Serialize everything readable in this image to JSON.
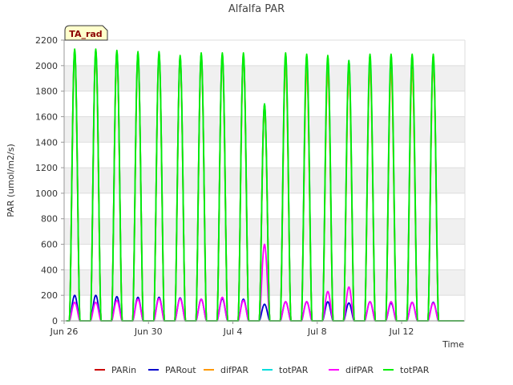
{
  "chart_data": {
    "type": "line",
    "title": "Alfalfa PAR",
    "xlabel": "Time",
    "ylabel": "PAR (umol/m2/s)",
    "badge": "TA_rad",
    "xlim": [
      "2023-06-26",
      "2023-07-15"
    ],
    "ylim": [
      0,
      2200
    ],
    "yticks": [
      0,
      200,
      400,
      600,
      800,
      1000,
      1200,
      1400,
      1600,
      1800,
      2000,
      2200
    ],
    "xticks": [
      {
        "date": "2023-06-26",
        "label": "Jun 26"
      },
      {
        "date": "2023-06-30",
        "label": "Jun 30"
      },
      {
        "date": "2023-07-04",
        "label": "Jul 4"
      },
      {
        "date": "2023-07-08",
        "label": "Jul 8"
      },
      {
        "date": "2023-07-12",
        "label": "Jul 12"
      }
    ],
    "grid": "horizontal bands",
    "legend_position": "bottom",
    "days": [
      "2023-06-26",
      "2023-06-27",
      "2023-06-28",
      "2023-06-29",
      "2023-06-30",
      "2023-07-01",
      "2023-07-02",
      "2023-07-03",
      "2023-07-04",
      "2023-07-05",
      "2023-07-06",
      "2023-07-07",
      "2023-07-08",
      "2023-07-09",
      "2023-07-10",
      "2023-07-11",
      "2023-07-12",
      "2023-07-13"
    ],
    "series": [
      {
        "name": "PARin",
        "color": "#cc0000",
        "daily_peak": [
          2110,
          2110,
          2100,
          2090,
          2090,
          2060,
          2080,
          2080,
          2080,
          1690,
          2030,
          2000,
          1990,
          1960,
          2010,
          1990,
          1990,
          2050
        ]
      },
      {
        "name": "PARout",
        "color": "#0000cc",
        "daily_peak": [
          200,
          200,
          190,
          185,
          185,
          180,
          170,
          175,
          170,
          130,
          150,
          150,
          150,
          140,
          150,
          140,
          145,
          145
        ]
      },
      {
        "name": "difPAR",
        "color": "#ff9900",
        "daily_peak": [
          2090,
          2090,
          2080,
          2070,
          2070,
          2040,
          2060,
          2060,
          2060,
          1670,
          2010,
          1980,
          1970,
          1940,
          1990,
          1970,
          1970,
          2030
        ]
      },
      {
        "name": "totPAR",
        "color": "#00dddd",
        "daily_peak": [
          2120,
          2120,
          2110,
          2100,
          2100,
          2070,
          2090,
          2090,
          2090,
          1700,
          2090,
          2080,
          2070,
          2040,
          2080,
          2080,
          2080,
          2080
        ]
      },
      {
        "name": "difPAR",
        "color": "#ff00ff",
        "daily_peak": [
          145,
          145,
          160,
          170,
          175,
          175,
          170,
          185,
          160,
          600,
          150,
          150,
          230,
          265,
          150,
          150,
          145,
          140
        ]
      },
      {
        "name": "totPAR",
        "color": "#00ee00",
        "daily_peak": [
          2130,
          2130,
          2120,
          2110,
          2110,
          2080,
          2100,
          2100,
          2100,
          1700,
          2100,
          2090,
          2080,
          2040,
          2090,
          2090,
          2090,
          2090
        ]
      }
    ]
  }
}
